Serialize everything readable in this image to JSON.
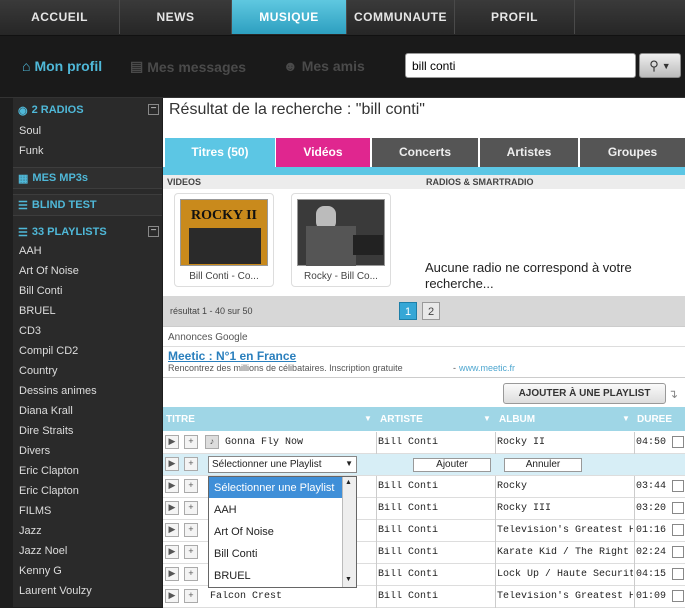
{
  "nav": {
    "tabs": [
      {
        "label": "ACCUEIL"
      },
      {
        "label": "NEWS"
      },
      {
        "label": "MUSIQUE"
      },
      {
        "label": "COMMUNAUTE"
      },
      {
        "label": "PROFIL"
      }
    ],
    "active": "MUSIQUE"
  },
  "subnav": {
    "profile": "Mon profil",
    "messages": "Mes messages",
    "friends": "Mes amis"
  },
  "search": {
    "value": "bill conti"
  },
  "sidebar": {
    "radios": {
      "label": "2 RADIOS",
      "items": [
        "Soul",
        "Funk"
      ]
    },
    "mp3": {
      "label": "MES MP3s"
    },
    "blind": {
      "label": "BLIND TEST"
    },
    "playlists": {
      "label": "33 PLAYLISTS",
      "items": [
        "AAH",
        "Art Of Noise",
        "Bill Conti",
        "BRUEL",
        "CD3",
        "Compil CD2",
        "Country",
        "Dessins animes",
        "Diana Krall",
        "Dire Straits",
        "Divers",
        "Eric Clapton",
        "Eric Clapton",
        "FILMS",
        "Jazz",
        "Jazz Noel",
        "Kenny G",
        "Laurent Voulzy"
      ]
    }
  },
  "results": {
    "title": "Résultat de la recherche : \"bill conti\"",
    "tabs": [
      "Titres (50)",
      "Vidéos",
      "Concerts",
      "Artistes",
      "Groupes"
    ],
    "videos_header": "VIDEOS",
    "radios_header": "RADIOS & SMARTRADIO",
    "videos": [
      {
        "caption": "Bill Conti - Co...",
        "thumb_text": "ROCKY II"
      },
      {
        "caption": "Rocky - Bill Co..."
      }
    ],
    "no_radio": "Aucune radio ne correspond à votre recherche...",
    "range": "résultat 1 - 40 sur 50",
    "pages": [
      "1",
      "2"
    ],
    "current_page": "1"
  },
  "ads": {
    "header": "Annonces Google",
    "link": "Meetic : N°1 en France",
    "text": "Rencontrez des millions de célibataires. Inscription gratuite",
    "url": "www.meetic.fr"
  },
  "add_playlist_button": "AJOUTER À UNE PLAYLIST",
  "table": {
    "headers": {
      "title": "TITRE",
      "artist": "ARTISTE",
      "album": "ALBUM",
      "duration": "DUREE"
    },
    "rows": [
      {
        "title": "Gonna Fly Now",
        "artist": "Bill Conti",
        "album": "Rocky II",
        "duration": "04:50"
      },
      {
        "title": "",
        "artist": "Bill Conti",
        "album": "Rocky",
        "duration": "03:44"
      },
      {
        "title": "",
        "artist": "Bill Conti",
        "album": "Rocky III",
        "duration": "03:20"
      },
      {
        "title": "",
        "artist": "Bill Conti",
        "album": "Television's Greatest Hit",
        "duration": "01:16"
      },
      {
        "title": "",
        "artist": "Bill Conti",
        "album": "Karate Kid / The Right St",
        "duration": "02:24"
      },
      {
        "title": "",
        "artist": "Bill Conti",
        "album": "Lock Up / Haute Securite",
        "duration": "04:15"
      },
      {
        "title": "Falcon Crest",
        "artist": "Bill Conti",
        "album": "Television's Greatest Hit",
        "duration": "01:09"
      }
    ]
  },
  "playlist_select": {
    "selected": "Sélectionner une Playlist",
    "add": "Ajouter",
    "cancel": "Annuler",
    "options": [
      "Sélectionner une Playlist",
      "AAH",
      "Art Of Noise",
      "Bill Conti",
      "BRUEL"
    ]
  },
  "colors": {
    "accent": "#4fb8d8",
    "videos_tab": "#e0268f",
    "header": "#9fd6e6"
  }
}
